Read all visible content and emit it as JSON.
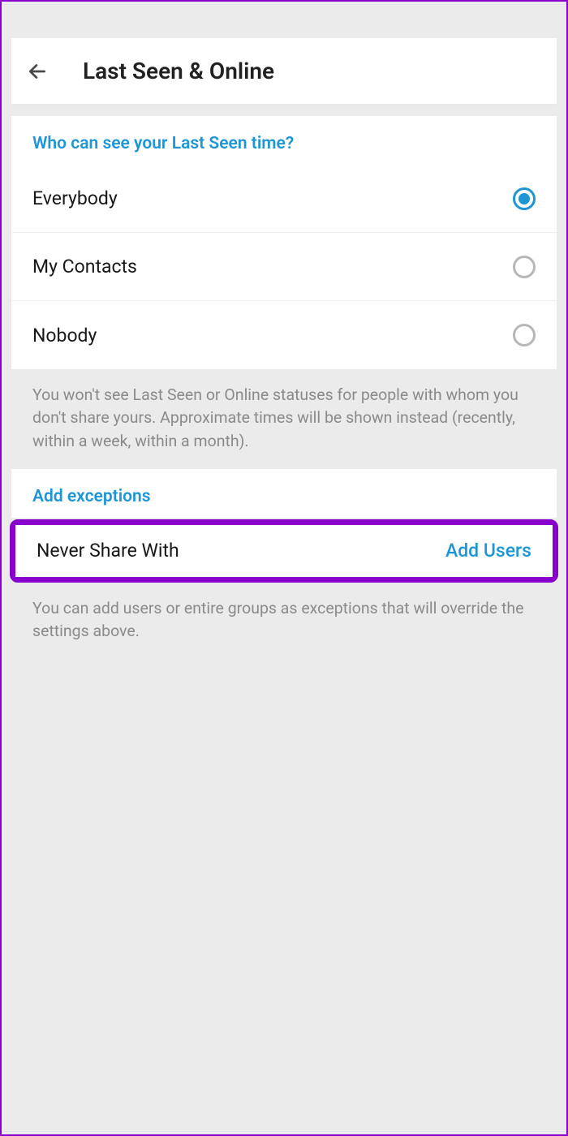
{
  "header": {
    "title": "Last Seen & Online"
  },
  "visibility": {
    "section_header": "Who can see your Last Seen time?",
    "options": [
      {
        "label": "Everybody",
        "selected": true
      },
      {
        "label": "My Contacts",
        "selected": false
      },
      {
        "label": "Nobody",
        "selected": false
      }
    ],
    "info": "You won't see Last Seen or Online statuses for people with whom you don't share yours. Approximate times will be shown instead (recently, within a week, within a month)."
  },
  "exceptions": {
    "section_header": "Add exceptions",
    "never_share_label": "Never Share With",
    "never_share_action": "Add Users",
    "info": "You can add users or entire groups as exceptions that will override the settings above."
  }
}
